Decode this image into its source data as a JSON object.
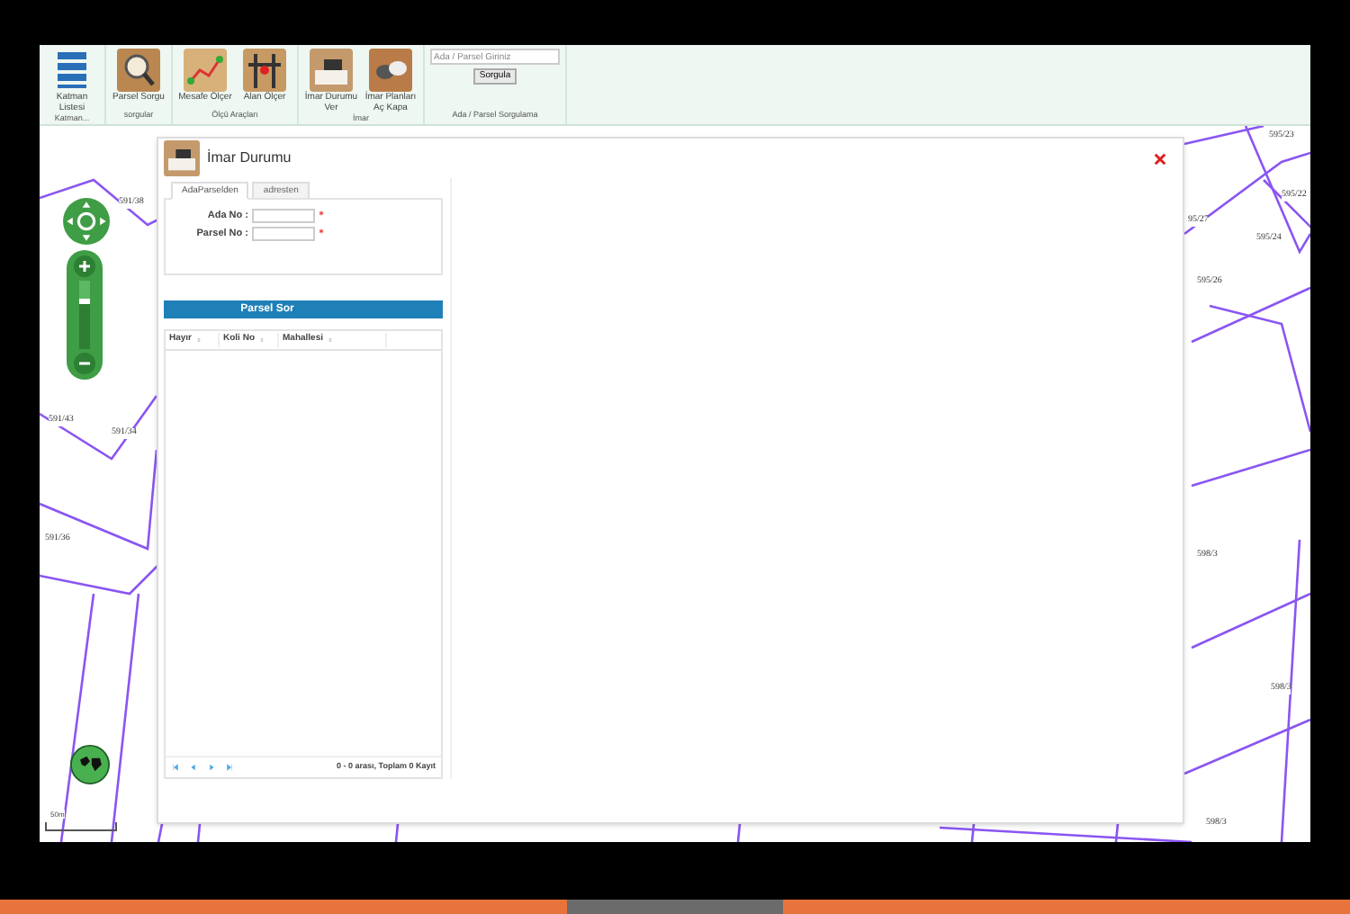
{
  "toolbar": {
    "groups": [
      {
        "label": "Katman...",
        "tools": [
          {
            "label": "Katman Listesi",
            "kind": "layers"
          }
        ]
      },
      {
        "label": "sorgular",
        "tools": [
          {
            "label": "Parsel Sorgu",
            "kind": "search"
          }
        ]
      },
      {
        "label": "Ölçü Araçları",
        "tools": [
          {
            "label": "Mesafe Ölçer",
            "kind": "distance"
          },
          {
            "label": "Alan Ölçer",
            "kind": "area"
          }
        ]
      },
      {
        "label": "İmar",
        "tools": [
          {
            "label": "İmar Durumu Ver",
            "kind": "stamp"
          },
          {
            "label": "İmar Planları Aç Kapa",
            "kind": "plans"
          }
        ]
      },
      {
        "label": "Ada / Parsel Sorgulama",
        "search": {
          "placeholder": "Ada / Parsel Giriniz",
          "button": "Sorgula"
        }
      }
    ]
  },
  "map": {
    "parcel_labels": [
      "591/38",
      "595/23",
      "595/22",
      "95/27",
      "595/24",
      "595/26",
      "591/43",
      "591/34",
      "591/36",
      "598/3",
      "598/3",
      "598/3"
    ],
    "zoom": {
      "level": 0.75
    },
    "scale": "50m"
  },
  "dialog": {
    "title": "İmar Durumu",
    "tabs": [
      {
        "label": "AdaParselden",
        "selected": true
      },
      {
        "label": "adresten",
        "selected": false
      }
    ],
    "fields": [
      {
        "label": "Ada No :",
        "required": true
      },
      {
        "label": "Parsel No :",
        "required": true
      }
    ],
    "button": "Parsel Sor",
    "columns": [
      "Hayır",
      "Koli No",
      "Mahallesi"
    ],
    "pager": "0 - 0 arası, Toplam 0 Kayıt"
  }
}
